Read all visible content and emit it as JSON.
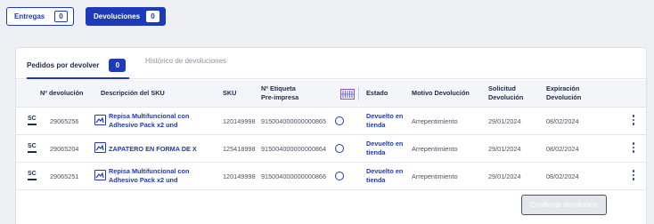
{
  "top_tabs": [
    {
      "label": "Entregas",
      "count": "0"
    },
    {
      "label": "Devoluciones",
      "count": "0"
    }
  ],
  "subtabs": {
    "active_label": "Pedidos por devolver",
    "active_count": "0",
    "inactive_label": "Histórico de devoluciones"
  },
  "table": {
    "headers": {
      "devolucion": "Nº devolución",
      "descripcion": "Descripción del SKU",
      "sku": "SKU",
      "etiqueta_1": "Nº Etiqueta",
      "etiqueta_2": "Pre-impresa",
      "estado": "Estado",
      "motivo": "Motivo Devolución",
      "solicitud_1": "Solicitud",
      "solicitud_2": "Devolución",
      "expiracion_1": "Expiración",
      "expiracion_2": "Devolución"
    },
    "rows": [
      {
        "devolucion": "29065256",
        "desc_1": "Repisa Multifuncional con",
        "desc_2": "Adhesivo Pack x2 und",
        "sku": "120149998",
        "etiqueta": "915004000000000865",
        "estado_1": "Devuelto en",
        "estado_2": "tienda",
        "motivo": "Arrepentimiento",
        "solicitud": "29/01/2024",
        "expiracion": "08/02/2024"
      },
      {
        "devolucion": "29065204",
        "desc_1": "ZAPATERO EN FORMA DE X",
        "desc_2": "",
        "sku": "125418998",
        "etiqueta": "915004000000000864",
        "estado_1": "Devuelto en",
        "estado_2": "tienda",
        "motivo": "Arrepentimiento",
        "solicitud": "29/01/2024",
        "expiracion": "08/02/2024"
      },
      {
        "devolucion": "29065251",
        "desc_1": "Repisa Multifuncional con",
        "desc_2": "Adhesivo Pack x2 und",
        "sku": "120149998",
        "etiqueta": "915004000000000866",
        "estado_1": "Devuelto en",
        "estado_2": "tienda",
        "motivo": "Arrepentimiento",
        "solicitud": "29/01/2024",
        "expiracion": "08/02/2024"
      }
    ]
  },
  "icons": {
    "row_type": "sc-logo-icon",
    "product": "image-icon",
    "status": "check-circle-icon",
    "actions": "kebab-menu-icon",
    "header_column": "barcode-grid-icon"
  },
  "sc_icon_text": "SC",
  "confirm_button": "Confirmar devolución",
  "colors": {
    "accent": "#1d3bb8",
    "background": "#eef0f3",
    "text": "#1e2a4a"
  }
}
